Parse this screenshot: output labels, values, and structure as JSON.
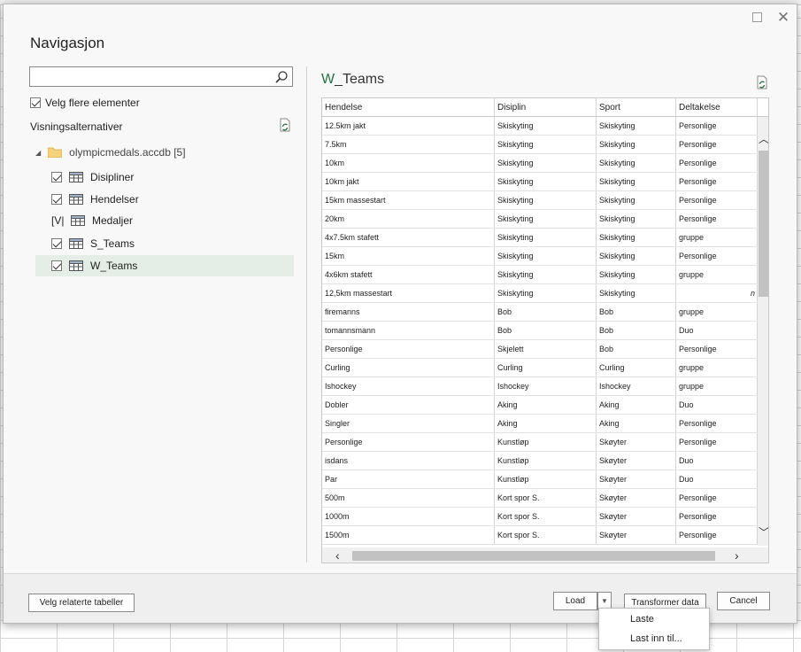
{
  "dialog": {
    "title": "Navigasjon",
    "search": {
      "value": "",
      "placeholder": ""
    },
    "multi_select_label": "Velg flere elementer",
    "multi_select_checked": true,
    "display_options_label": "Visningsalternativer"
  },
  "tree": {
    "root_label": "olympicmedals.accdb [5]",
    "items": [
      {
        "label": "Disipliner",
        "state": "checked",
        "selected": false
      },
      {
        "label": "Hendelser",
        "state": "checked",
        "selected": false
      },
      {
        "label": "Medaljer",
        "state": "mixed",
        "mixed_glyph": "[V|",
        "selected": false
      },
      {
        "label": "S_Teams",
        "state": "checked",
        "selected": false
      },
      {
        "label": "W_Teams",
        "state": "checked",
        "selected": true
      }
    ]
  },
  "preview": {
    "title_prefix": "W",
    "title_rest": "_Teams",
    "columns": [
      "Hendelse",
      "Disiplin",
      "Sport",
      "Deltakelse"
    ],
    "rows": [
      [
        "12.5km jakt",
        "Skiskyting",
        "Skiskyting",
        "Personlige"
      ],
      [
        "7.5km",
        "Skiskyting",
        "Skiskyting",
        "Personlige"
      ],
      [
        "10km",
        "Skiskyting",
        "Skiskyting",
        "Personlige"
      ],
      [
        "10km jakt",
        "Skiskyting",
        "Skiskyting",
        "Personlige"
      ],
      [
        "15km massestart",
        "Skiskyting",
        "Skiskyting",
        "Personlige"
      ],
      [
        "20km",
        "Skiskyting",
        "Skiskyting",
        "Personlige"
      ],
      [
        "4x7.5km stafett",
        "Skiskyting",
        "Skiskyting",
        "gruppe"
      ],
      [
        "15km",
        "Skiskyting",
        "Skiskyting",
        "Personlige"
      ],
      [
        "4x6km stafett",
        "Skiskyting",
        "Skiskyting",
        "gruppe"
      ],
      [
        "12,5km massestart",
        "Skiskyting",
        "Skiskyting",
        "n"
      ],
      [
        "firemanns",
        "Bob",
        "Bob",
        "gruppe"
      ],
      [
        "tomannsmann",
        "Bob",
        "Bob",
        "Duo"
      ],
      [
        "Personlige",
        "Skjelett",
        "Bob",
        "Personlige"
      ],
      [
        "Curling",
        "Curling",
        "Curling",
        "gruppe"
      ],
      [
        "Ishockey",
        "Ishockey",
        "Ishockey",
        "gruppe"
      ],
      [
        "Dobler",
        "Aking",
        "Aking",
        "Duo"
      ],
      [
        "Singler",
        "Aking",
        "Aking",
        "Personlige"
      ],
      [
        "Personlige",
        "Kunstløp",
        "Skøyter",
        "Personlige"
      ],
      [
        "isdans",
        "Kunstløp",
        "Skøyter",
        "Duo"
      ],
      [
        "Par",
        "Kunstløp",
        "Skøyter",
        "Duo"
      ],
      [
        "500m",
        "Kort spor S.",
        "Skøyter",
        "Personlige"
      ],
      [
        "1000m",
        "Kort spor S.",
        "Skøyter",
        "Personlige"
      ],
      [
        "1500m",
        "Kort spor S.",
        "Skøyter",
        "Personlige"
      ]
    ]
  },
  "footer": {
    "related_tables_label": "Velg relaterte tabeller",
    "load_label": "Load",
    "transform_label": "Transformer data",
    "cancel_label": "Cancel"
  },
  "load_menu": {
    "items": [
      "Laste",
      "Last inn til..."
    ]
  },
  "colors": {
    "accent_green": "#217346",
    "selection_bg": "#e4eee6"
  }
}
